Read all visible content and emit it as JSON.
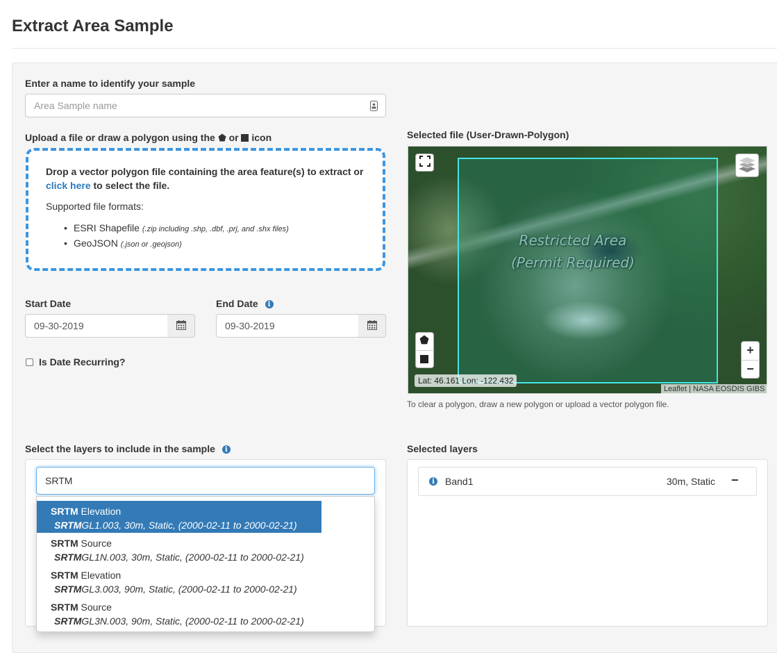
{
  "page": {
    "title": "Extract Area Sample"
  },
  "sample_name": {
    "label": "Enter a name to identify your sample",
    "placeholder": "Area Sample name"
  },
  "upload": {
    "label_prefix": "Upload a file or draw a polygon using the",
    "label_or": "or",
    "label_suffix": "icon",
    "drop_text": "Drop a vector polygon file containing the area feature(s) to extract or",
    "click_here": "click here",
    "drop_text_end": "to select the file.",
    "formats_title": "Supported file formats:",
    "formats": [
      {
        "name": "ESRI Shapefile",
        "note": "(.zip including .shp, .dbf, .prj, and .shx files)"
      },
      {
        "name": "GeoJSON",
        "note": "(.json or .geojson)"
      }
    ]
  },
  "dates": {
    "start_label": "Start Date",
    "start_value": "09-30-2019",
    "end_label": "End Date",
    "end_value": "09-30-2019",
    "recurring_label": "Is Date Recurring?",
    "recurring_checked": false
  },
  "map": {
    "label": "Selected file (User-Drawn-Polygon)",
    "area_label": "Restricted Area (Permit Required)",
    "coords": "Lat: 46.161 Lon: -122.432",
    "attribution": "Leaflet | NASA EOSDIS GIBS",
    "zoom_in": "+",
    "zoom_out": "−",
    "hint": "To clear a polygon, draw a new polygon or upload a vector polygon file.",
    "polygon_color": "#44e6e6"
  },
  "layers": {
    "label": "Select the layers to include in the sample",
    "search_value": "SRTM",
    "options": [
      {
        "match": "SRTM",
        "rest": " Elevation",
        "sub_match": "SRTM",
        "sub_rest": "GL1.003, 30m, Static, (2000-02-11 to 2000-02-21)",
        "active": true
      },
      {
        "match": "SRTM",
        "rest": " Source",
        "sub_match": "SRTM",
        "sub_rest": "GL1N.003, 30m, Static, (2000-02-11 to 2000-02-21)",
        "active": false
      },
      {
        "match": "SRTM",
        "rest": " Elevation",
        "sub_match": "SRTM",
        "sub_rest": "GL3.003, 90m, Static, (2000-02-11 to 2000-02-21)",
        "active": false
      },
      {
        "match": "SRTM",
        "rest": " Source",
        "sub_match": "SRTM",
        "sub_rest": "GL3N.003, 90m, Static, (2000-02-11 to 2000-02-21)",
        "active": false
      }
    ]
  },
  "selected_layers": {
    "label": "Selected layers",
    "items": [
      {
        "name": "Band1",
        "meta": "30m, Static",
        "remove": "−"
      }
    ]
  },
  "colors": {
    "accent": "#337ab7",
    "dropzone_border": "#3c96e0"
  }
}
